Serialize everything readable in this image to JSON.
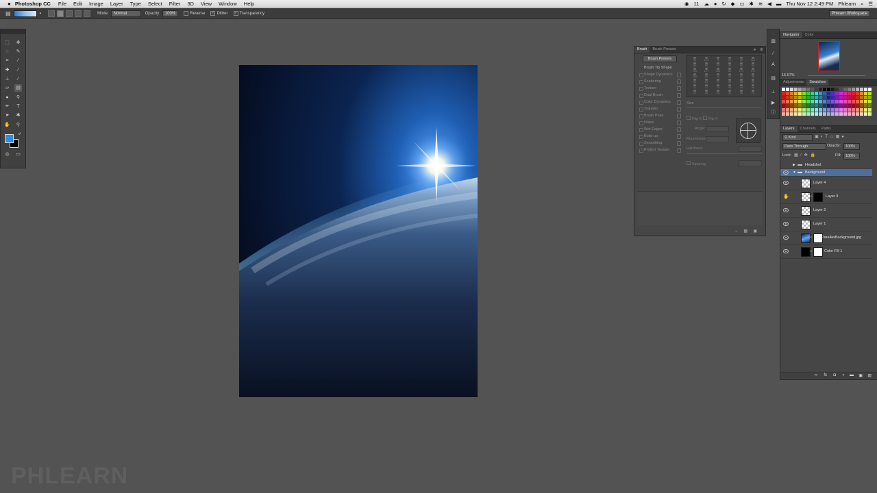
{
  "app": {
    "menu": [
      "File",
      "Edit",
      "Image",
      "Layer",
      "Type",
      "Select",
      "Filter",
      "3D",
      "View",
      "Window",
      "Help"
    ],
    "name": "Photoshop CC",
    "status": {
      "time": "Thu Nov 12  2:49 PM",
      "user": "Phlearn",
      "battery_glyph": "11"
    }
  },
  "options_bar": {
    "mode_label": "Mode:",
    "mode_value": "Normal",
    "opacity_label": "Opacity:",
    "opacity_value": "100%",
    "reverse": "Reverse",
    "dither": "Dither",
    "transparency": "Transparency",
    "workspace": "Phlearn Workspace"
  },
  "brush_panel": {
    "tabs": [
      "Brush",
      "Brush Presets"
    ],
    "presets_button": "Brush Presets",
    "items": [
      "Brush Tip Shape",
      "Shape Dynamics",
      "Scattering",
      "Texture",
      "Dual Brush",
      "Color Dynamics",
      "Transfer",
      "Brush Pose",
      "Noise",
      "Wet Edges",
      "Build-up",
      "Smoothing",
      "Protect Texture"
    ],
    "size_label": "Size",
    "flip_x": "Flip X",
    "flip_y": "Flip Y",
    "angle_label": "Angle:",
    "roundness_label": "Roundness:",
    "hardness_label": "Hardness",
    "spacing_label": "Spacing",
    "preset_sizes": [
      "30",
      "123",
      "8",
      "10",
      "25",
      "112",
      "60",
      "50",
      "25",
      "30",
      "50",
      "60",
      "100",
      "127",
      "284",
      "80",
      "174",
      "175",
      "306",
      "50",
      "16",
      "25",
      "20",
      "36",
      "14",
      "24",
      "27",
      "39",
      "46",
      "59",
      "11",
      "17",
      "23",
      "36",
      "44",
      "60",
      "14",
      "26",
      "33",
      "42",
      "55",
      "70"
    ]
  },
  "navigator": {
    "tabs": [
      "Navigator",
      "Color"
    ],
    "zoom": "16.67%"
  },
  "swatches_panel": {
    "tabs": [
      "Adjustments",
      "Swatches"
    ]
  },
  "layers_panel": {
    "tabs": [
      "Layers",
      "Channels",
      "Paths"
    ],
    "kind": "Kind",
    "blend_mode": "Pass Through",
    "opacity_label": "Opacity:",
    "opacity_value": "100%",
    "lock_label": "Lock:",
    "fill_label": "Fill:",
    "fill_value": "100%",
    "layers": [
      {
        "name": "Headshot",
        "type": "group-collapsed"
      },
      {
        "name": "Background",
        "type": "group-expanded",
        "selected": true
      },
      {
        "name": "Layer 4",
        "type": "layer"
      },
      {
        "name": "Layer 3",
        "type": "layer-mask"
      },
      {
        "name": "Layer 2",
        "type": "layer"
      },
      {
        "name": "Layer 1",
        "type": "layer"
      },
      {
        "name": "ParallaxBackground.jpg",
        "type": "image-mask"
      },
      {
        "name": "Color Fill 1",
        "type": "fill"
      }
    ]
  },
  "watermark": "PHLEARN",
  "colors": {
    "bg": "#535353",
    "panel": "#464646",
    "accent": "#3b6fb6",
    "fg_swatch": "#2d8de0",
    "bg_swatch": "#000000"
  }
}
